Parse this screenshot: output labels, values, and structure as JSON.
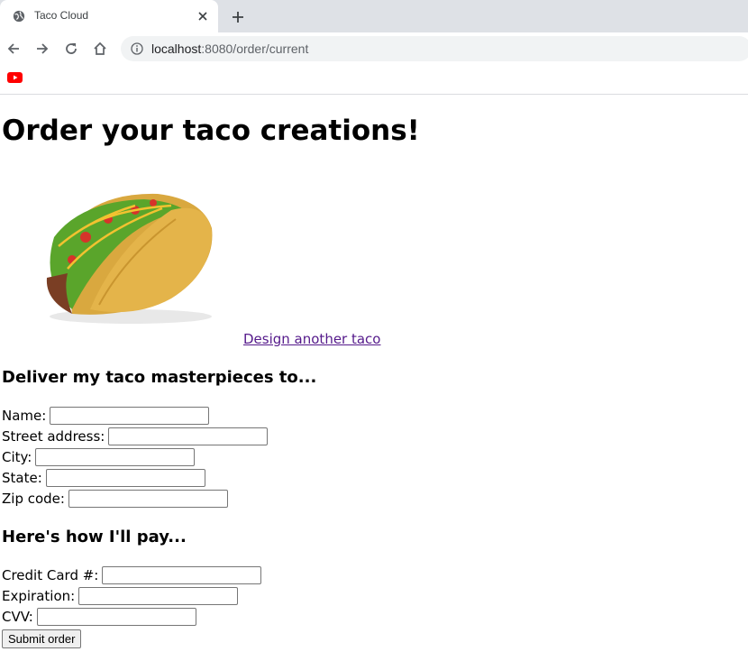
{
  "browser": {
    "tab_title": "Taco Cloud",
    "url_host": "localhost",
    "url_rest": ":8080/order/current",
    "bookmark_icon": "youtube-icon"
  },
  "page": {
    "title": "Order your taco creations!",
    "design_link": "Design another taco",
    "delivery_heading": "Deliver my taco masterpieces to...",
    "payment_heading": "Here's how I'll pay...",
    "delivery_fields": [
      {
        "label": "Name:",
        "value": ""
      },
      {
        "label": "Street address:",
        "value": ""
      },
      {
        "label": "City:",
        "value": ""
      },
      {
        "label": "State:",
        "value": ""
      },
      {
        "label": "Zip code:",
        "value": ""
      }
    ],
    "payment_fields": [
      {
        "label": "Credit Card #:",
        "value": ""
      },
      {
        "label": "Expiration:",
        "value": ""
      },
      {
        "label": "CVV:",
        "value": ""
      }
    ],
    "submit_label": "Submit order"
  },
  "colors": {
    "link": "#551a8b",
    "tabstrip": "#dee1e6",
    "omnibox": "#f1f3f4",
    "youtube": "#ff0000"
  }
}
